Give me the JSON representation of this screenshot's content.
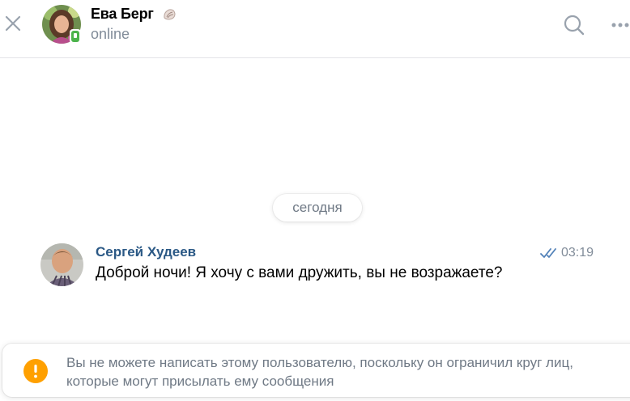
{
  "header": {
    "contact_name": "Ева Берг",
    "status": "online",
    "status_emoji": "shell-icon",
    "icons": {
      "close": "close-icon",
      "search": "search-icon",
      "more": "more-horizontal-icon"
    }
  },
  "conversation": {
    "date_separator": "сегодня",
    "messages": [
      {
        "author": "Сергей Худеев",
        "time": "03:19",
        "text": "Доброй ночи! Я хочу с вами дружить, вы не возражаете?",
        "read": true
      }
    ]
  },
  "notice": {
    "icon": "info-icon",
    "text": "Вы не можете написать этому пользователю, поскольку он ограничил круг лиц, которые могут присылать ему сообщения"
  },
  "colors": {
    "accent": "#2a5885",
    "secondary_text": "#818c99",
    "online": "#4bb34b",
    "info": "#ffa000",
    "divider": "#e3e4e8"
  }
}
